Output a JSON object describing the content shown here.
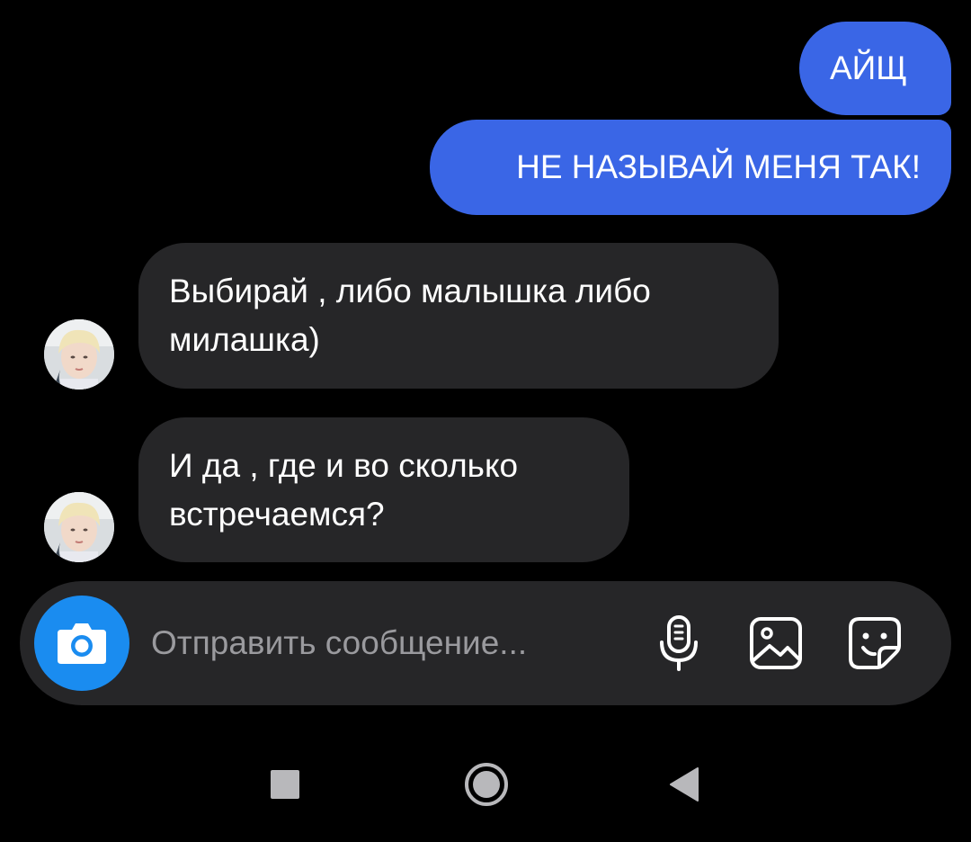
{
  "messages": [
    {
      "direction": "sent",
      "text": "АЙЩ"
    },
    {
      "direction": "sent",
      "text": "НЕ НАЗЫВАЙ МЕНЯ ТАК!"
    },
    {
      "direction": "received",
      "text": "Выбирай , либо малышка либо милашка)"
    },
    {
      "direction": "received",
      "text": "И да , где и во сколько встречаемся?"
    }
  ],
  "composer": {
    "placeholder": "Отправить сообщение...",
    "value": "",
    "camera_icon": "camera-icon",
    "mic_icon": "microphone-icon",
    "gallery_icon": "gallery-icon",
    "sticker_icon": "sticker-icon"
  },
  "navbar": {
    "recents_icon": "square-icon",
    "home_icon": "circle-icon",
    "back_icon": "triangle-back-icon"
  },
  "colors": {
    "background": "#000000",
    "sent_bubble": "#3a66e6",
    "received_bubble": "#262628",
    "camera_button": "#1a8cf0",
    "placeholder": "#9a9a9e",
    "nav_icons": "#b8b8bb"
  }
}
